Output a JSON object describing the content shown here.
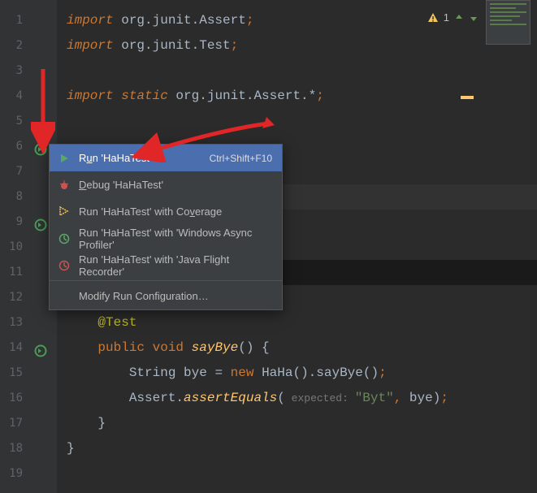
{
  "warnings": {
    "count": "1"
  },
  "lines": {
    "l1": {
      "kw": "import",
      "pkg": " org.junit.Assert",
      "sc": ";"
    },
    "l2": {
      "kw": "import",
      "pkg": " org.junit.Test",
      "sc": ";"
    },
    "l4": {
      "kw": "import static",
      "pkg": " org.junit.Assert.*",
      "sc": ";"
    },
    "l13": {
      "ann": "@Test"
    },
    "l14": {
      "mod": "public ",
      "ret": "void ",
      "name": "sayBye",
      "sig": "() {"
    },
    "l15": {
      "type": "String ",
      "var": "bye",
      "eq": " = ",
      "newkw": "new ",
      "cls": "HaHa",
      "call": "().sayBye()",
      "sc": ";"
    },
    "l16": {
      "cls": "Assert",
      "dot": ".",
      "method": "assertEquals",
      "open": "(",
      "hint": " expected: ",
      "str": "\"Byt\"",
      "comma": ", ",
      "arg": "bye",
      "close": ")",
      "sc": ";"
    },
    "l17": {
      "brace": "}"
    },
    "l18": {
      "brace": "}"
    }
  },
  "menu": {
    "run_pre": "R",
    "run_mn": "u",
    "run_post": "n 'HaHaTest'",
    "run_kbd": "Ctrl+Shift+F10",
    "debug_pre": "",
    "debug_mn": "D",
    "debug_post": "ebug 'HaHaTest'",
    "cov_pre": "Run 'HaHaTest' with Co",
    "cov_mn": "v",
    "cov_post": "erage",
    "async": "Run 'HaHaTest' with 'Windows Async Profiler'",
    "jfr": "Run 'HaHaTest' with 'Java Flight Recorder'",
    "modify": "Modify Run Configuration…"
  }
}
